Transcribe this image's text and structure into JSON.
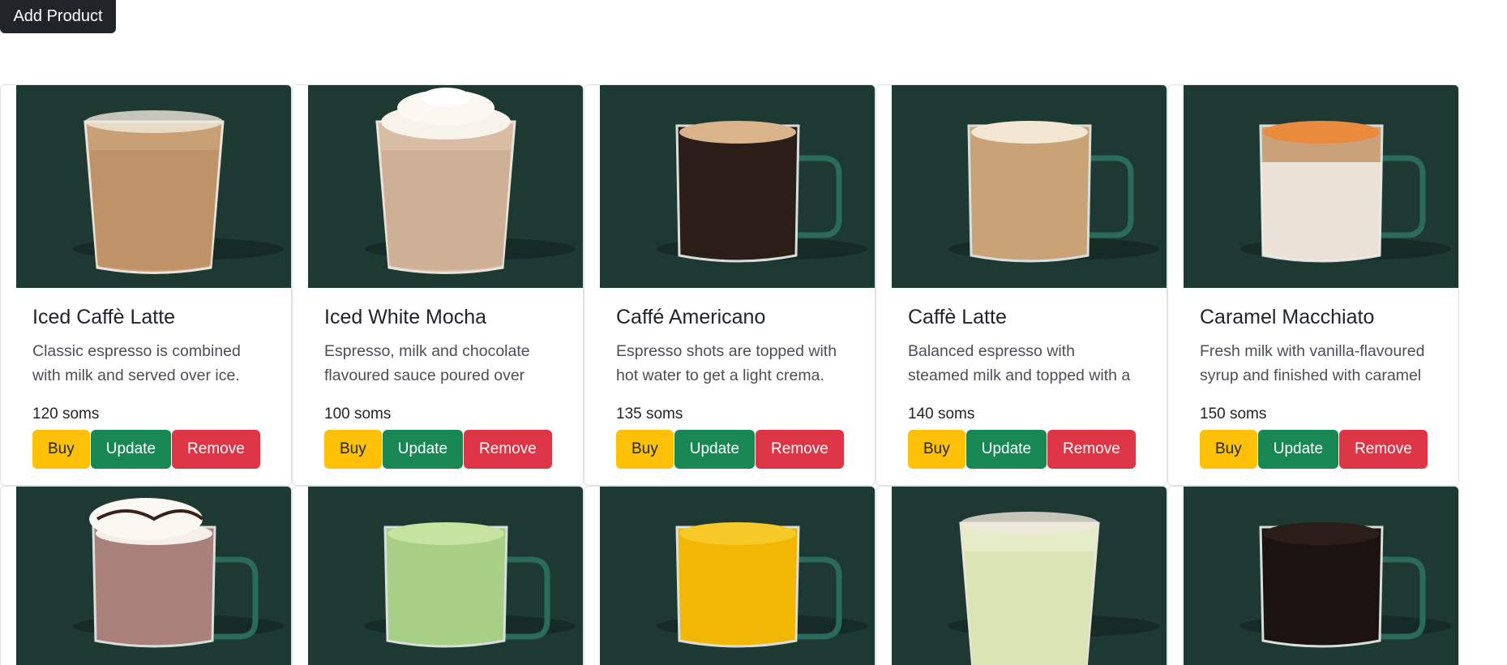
{
  "toolbar": {
    "add_label": "Add Product"
  },
  "products": [
    {
      "name": "Iced Caffè Latte",
      "desc": "Classic espresso is combined with milk and served over ice.",
      "price": "120 soms",
      "drink": "iced-latte"
    },
    {
      "name": "Iced White Mocha",
      "desc": "Espresso, milk and chocolate flavoured sauce poured over ice.",
      "price": "100 soms",
      "drink": "iced-mocha"
    },
    {
      "name": "Caffé Americano",
      "desc": "Espresso shots are topped with hot water to get a light crema.",
      "price": "135 soms",
      "drink": "americano"
    },
    {
      "name": "Caffè Latte",
      "desc": "Balanced espresso with steamed milk and topped with a foam.",
      "price": "140 soms",
      "drink": "latte"
    },
    {
      "name": "Caramel Macchiato",
      "desc": "Fresh milk with vanilla-flavoured syrup and finished with caramel",
      "price": "150 soms",
      "drink": "macchiato"
    }
  ],
  "row2_drinks": [
    "hot-chocolate",
    "matcha-latte",
    "yellow-tea",
    "iced-lemonade",
    "black-coffee"
  ],
  "buttons": {
    "buy": "Buy",
    "update": "Update",
    "remove": "Remove"
  },
  "colors": {
    "image_bg": "#1e3932",
    "buy": "#ffc107",
    "update": "#198754",
    "remove": "#dc3545",
    "dark": "#212529"
  }
}
